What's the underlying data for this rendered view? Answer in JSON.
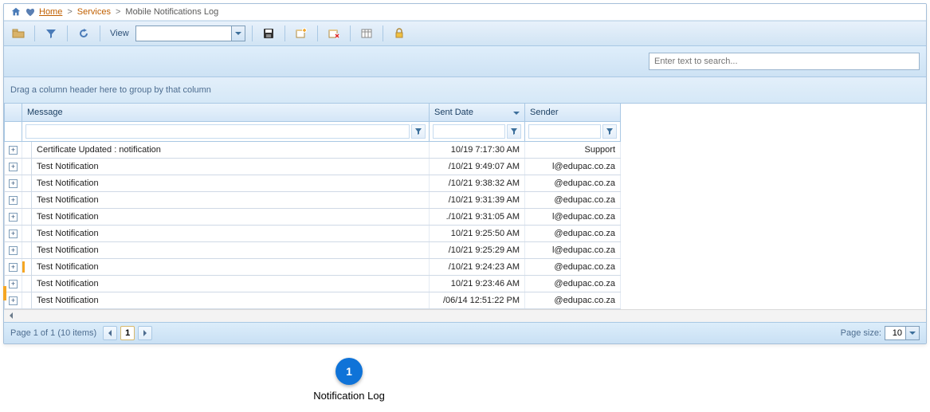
{
  "breadcrumb": {
    "home": "Home",
    "services": "Services",
    "current": "Mobile Notifications Log"
  },
  "toolbar": {
    "view_label": "View",
    "view_value": ""
  },
  "search": {
    "placeholder": "Enter text to search..."
  },
  "group_hint": "Drag a column header here to group by that column",
  "columns": {
    "message": "Message",
    "sent_date": "Sent Date",
    "sender": "Sender"
  },
  "filters": {
    "message": "",
    "sent_date": "",
    "sender": ""
  },
  "rows": [
    {
      "marked": false,
      "message": "Certificate Updated :        notification",
      "sent": "10/19 7:17:30 AM",
      "sender": "Support"
    },
    {
      "marked": false,
      "message": "Test Notification",
      "sent": "/10/21 9:49:07 AM",
      "sender": "l@edupac.co.za"
    },
    {
      "marked": false,
      "message": "Test Notification",
      "sent": "/10/21 9:38:32 AM",
      "sender": "@edupac.co.za"
    },
    {
      "marked": false,
      "message": "Test Notification",
      "sent": "/10/21 9:31:39 AM",
      "sender": "@edupac.co.za"
    },
    {
      "marked": false,
      "message": "Test Notification",
      "sent": "./10/21 9:31:05 AM",
      "sender": "l@edupac.co.za"
    },
    {
      "marked": false,
      "message": "Test Notification",
      "sent": "10/21 9:25:50 AM",
      "sender": "@edupac.co.za"
    },
    {
      "marked": false,
      "message": "Test Notification",
      "sent": "/10/21 9:25:29 AM",
      "sender": "l@edupac.co.za"
    },
    {
      "marked": true,
      "message": "Test Notification",
      "sent": "/10/21 9:24:23 AM",
      "sender": "@edupac.co.za"
    },
    {
      "marked": false,
      "message": "Test Notification",
      "sent": "10/21 9:23:46 AM",
      "sender": "@edupac.co.za"
    },
    {
      "marked": false,
      "message": "Test Notification",
      "sent": "/06/14 12:51:22 PM",
      "sender": "@edupac.co.za"
    }
  ],
  "pager": {
    "info": "Page 1 of 1 (10 items)",
    "current_page": "1",
    "page_size_label": "Page size:",
    "page_size": "10"
  },
  "callout": {
    "number": "1",
    "label": "Notification Log"
  }
}
